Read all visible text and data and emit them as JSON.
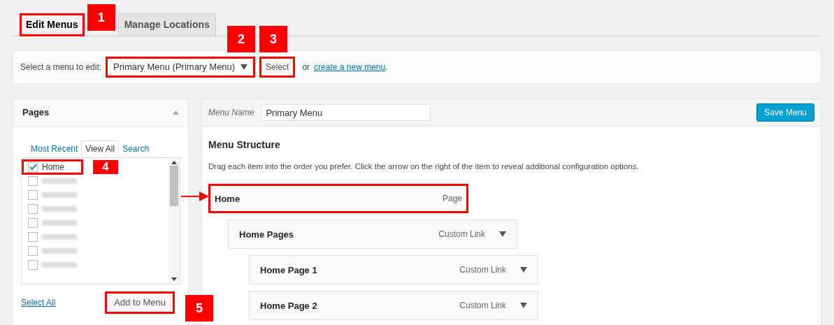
{
  "tabs": [
    {
      "label": "Edit Menus",
      "selected": true,
      "highlighted": true,
      "badge": "1"
    },
    {
      "label": "Manage Locations",
      "selected": false,
      "highlighted": false
    }
  ],
  "menu_select": {
    "label": "Select a menu to edit:",
    "value": "Primary Menu (Primary Menu)",
    "badge": "2",
    "button": "Select",
    "button_badge": "3",
    "or_text": "or",
    "link": "create a new menu",
    "period": "."
  },
  "pages_panel": {
    "title": "Pages",
    "expanded": true,
    "tabs": [
      {
        "label": "Most Recent",
        "selected": false
      },
      {
        "label": "View All",
        "selected": true
      },
      {
        "label": "Search",
        "selected": false
      }
    ],
    "items": [
      {
        "kind": "page",
        "label": "Home",
        "checked": true,
        "highlighted": true,
        "badge": "4"
      },
      {
        "kind": "redacted",
        "checked": false
      },
      {
        "kind": "redacted",
        "checked": false
      },
      {
        "kind": "redacted",
        "checked": false
      },
      {
        "kind": "redacted",
        "checked": false
      },
      {
        "kind": "redacted",
        "checked": false
      },
      {
        "kind": "redacted",
        "checked": false
      },
      {
        "kind": "redacted",
        "checked": false
      }
    ],
    "select_all": "Select All",
    "add_button": "Add to Menu",
    "add_badge": "5"
  },
  "menu_editor": {
    "name_label": "Menu Name",
    "name_value": "Primary Menu",
    "save_button": "Save Menu",
    "heading": "Menu Structure",
    "hint": "Drag each item into the order you prefer. Click the arrow on the right of the item to reveal additional configuration options.",
    "items": [
      {
        "title": "Home",
        "type": "Page",
        "highlighted": true,
        "children": [
          {
            "title": "Home Pages",
            "type": "Custom Link",
            "highlighted": false,
            "children": [
              {
                "title": "Home Page 1",
                "type": "Custom Link",
                "highlighted": false
              },
              {
                "title": "Home Page 2",
                "type": "Custom Link",
                "highlighted": false
              }
            ]
          }
        ]
      }
    ]
  }
}
